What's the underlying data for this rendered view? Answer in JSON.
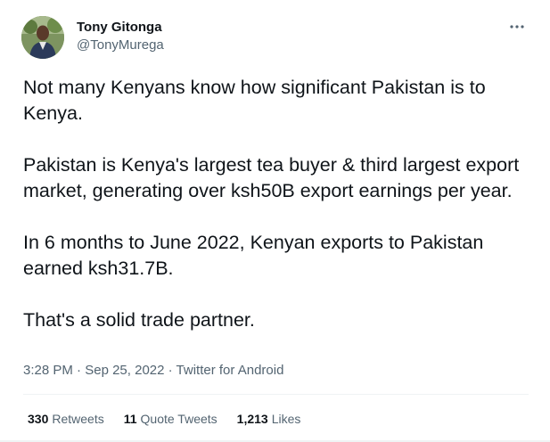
{
  "author": {
    "display_name": "Tony Gitonga",
    "handle": "@TonyMurega",
    "avatar_icon": "profile-photo"
  },
  "more_icon": "more-options-icon",
  "tweet": {
    "paragraphs": [
      "Not many Kenyans know how significant Pakistan is to Kenya.",
      "Pakistan is Kenya's largest tea buyer & third largest export market, generating over ksh50B export earnings per year.",
      "In 6 months to June 2022, Kenyan exports to Pakistan earned ksh31.7B.",
      "That's a solid trade partner."
    ]
  },
  "meta": {
    "time": "3:28 PM",
    "separator": " · ",
    "date": "Sep 25, 2022",
    "source": "Twitter for Android"
  },
  "stats": {
    "retweets_count": "330",
    "retweets_label": "Retweets",
    "quotes_count": "11",
    "quotes_label": "Quote Tweets",
    "likes_count": "1,213",
    "likes_label": "Likes"
  },
  "colors": {
    "text_primary": "#0f1419",
    "text_secondary": "#536471",
    "divider": "#eff3f4"
  }
}
